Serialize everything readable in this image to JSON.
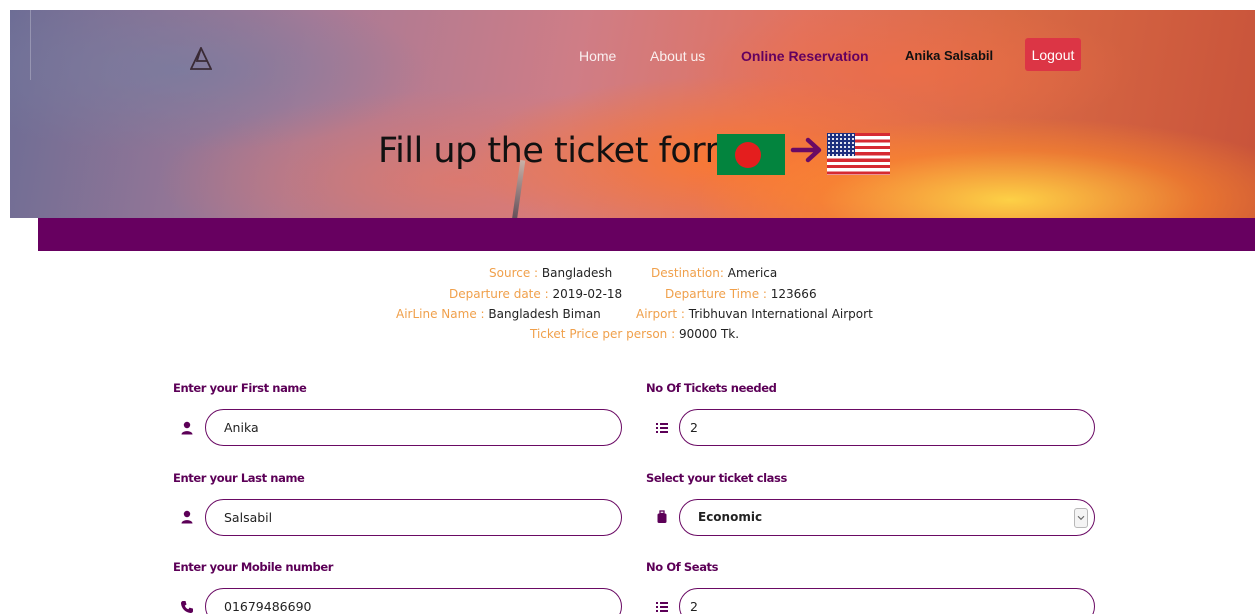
{
  "nav": {
    "home": "Home",
    "about": "About us",
    "online_reservation": "Online Reservation",
    "user_name": "Anika Salsabil",
    "logout": "Logout"
  },
  "hero": {
    "title": "Fill up the ticket form!"
  },
  "trip": {
    "source_label": "Source :",
    "source_value": "Bangladesh",
    "destination_label": "Destination:",
    "destination_value": "America",
    "departure_date_label": "Departure date :",
    "departure_date_value": "2019-02-18",
    "departure_time_label": "Departure Time :",
    "departure_time_value": "123666",
    "airline_label": "AirLine Name :",
    "airline_value": "Bangladesh Biman",
    "airport_label": "Airport :",
    "airport_value": "Tribhuvan International Airport",
    "price_label": "Ticket Price per person :",
    "price_value": "90000 Tk."
  },
  "form": {
    "first_name_label": "Enter your First name",
    "first_name_value": "Anika",
    "last_name_label": "Enter your Last name",
    "last_name_value": "Salsabil",
    "mobile_label": "Enter your Mobile number",
    "mobile_value": "01679486690",
    "tickets_label": "No Of Tickets needed",
    "tickets_value": "2",
    "class_label": "Select your ticket class",
    "class_value": "Economic",
    "seats_label": "No Of Seats",
    "seats_value": "2"
  },
  "icons": {
    "logo": "triangle-logo-icon",
    "user": "user-icon",
    "list": "list-icon",
    "luggage": "luggage-icon",
    "phone": "phone-icon",
    "arrow": "arrow-right-icon"
  },
  "colors": {
    "brand_purple": "#670060",
    "label_orange": "#f0a04b",
    "logout_red": "#dc3545"
  }
}
